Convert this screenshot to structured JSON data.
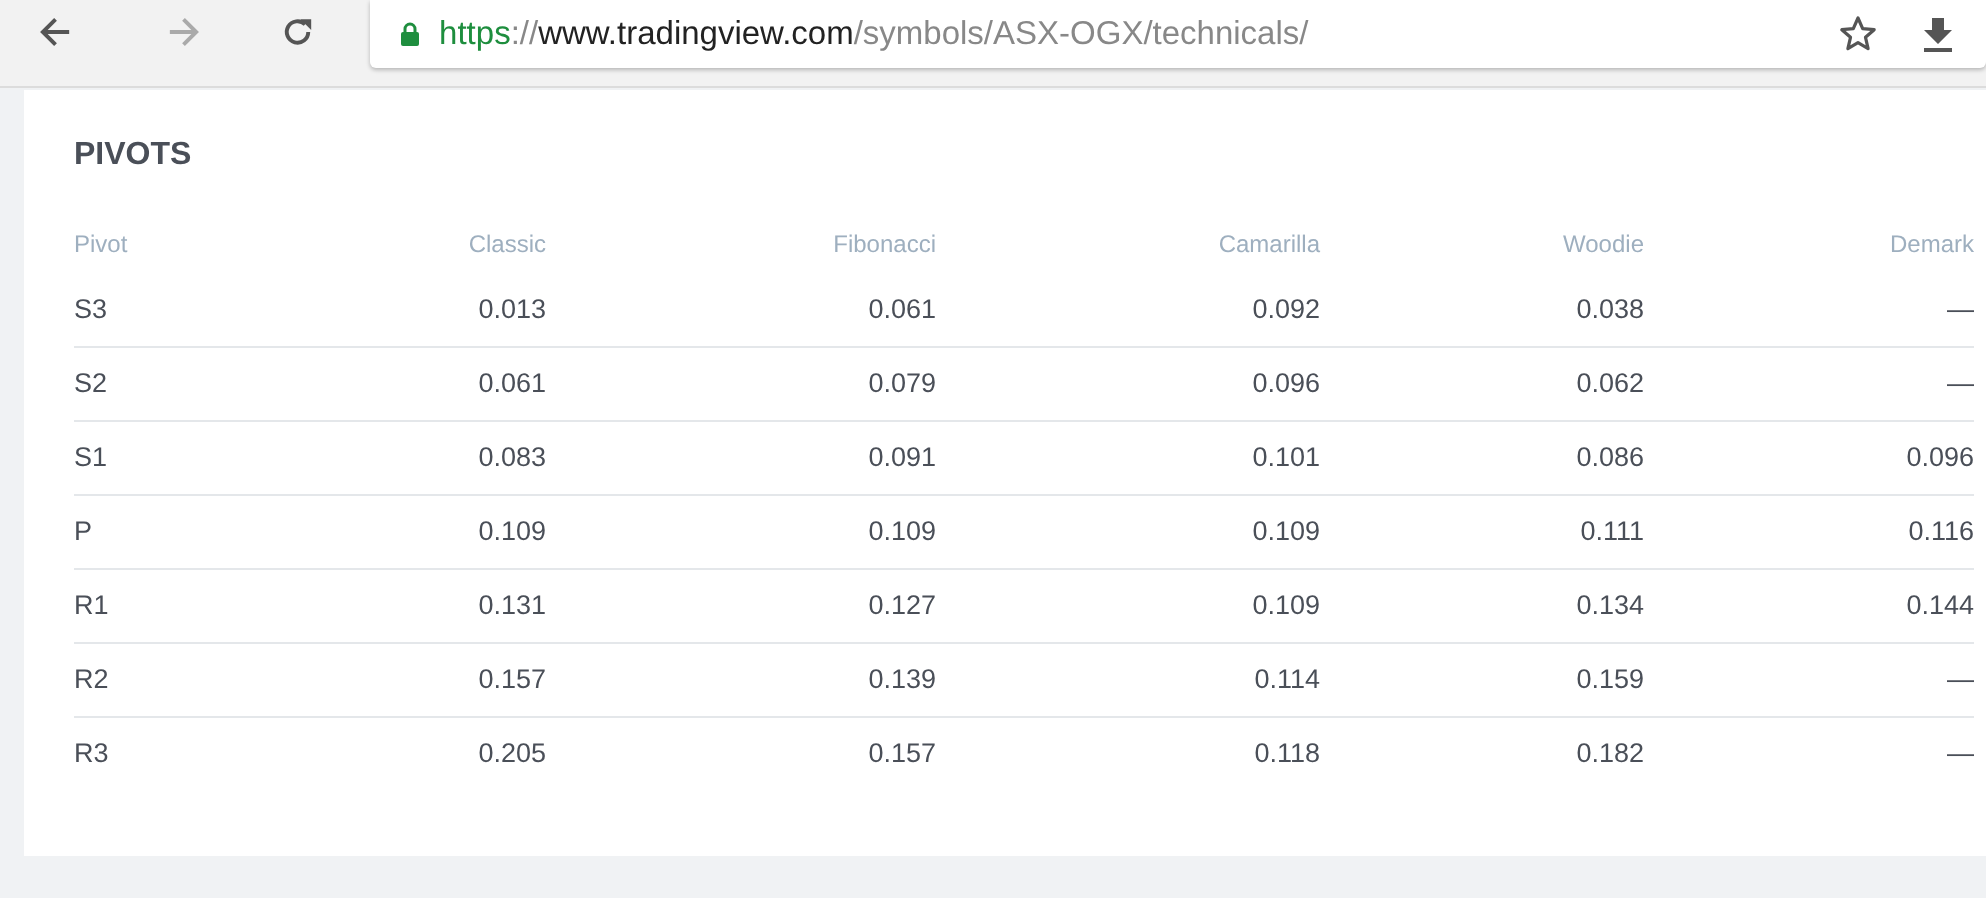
{
  "browser": {
    "url": {
      "scheme": "https",
      "separator": "://",
      "host": "www.tradingview.com",
      "path": "/symbols/ASX-OGX/technicals/"
    }
  },
  "pivots": {
    "title": "PIVOTS",
    "columns": [
      "Pivot",
      "Classic",
      "Fibonacci",
      "Camarilla",
      "Woodie",
      "Demark"
    ],
    "rows": [
      [
        "S3",
        "0.013",
        "0.061",
        "0.092",
        "0.038",
        "—"
      ],
      [
        "S2",
        "0.061",
        "0.079",
        "0.096",
        "0.062",
        "—"
      ],
      [
        "S1",
        "0.083",
        "0.091",
        "0.101",
        "0.086",
        "0.096"
      ],
      [
        "P",
        "0.109",
        "0.109",
        "0.109",
        "0.111",
        "0.116"
      ],
      [
        "R1",
        "0.131",
        "0.127",
        "0.109",
        "0.134",
        "0.144"
      ],
      [
        "R2",
        "0.157",
        "0.139",
        "0.114",
        "0.159",
        "—"
      ],
      [
        "R3",
        "0.205",
        "0.157",
        "0.118",
        "0.182",
        "—"
      ]
    ]
  }
}
